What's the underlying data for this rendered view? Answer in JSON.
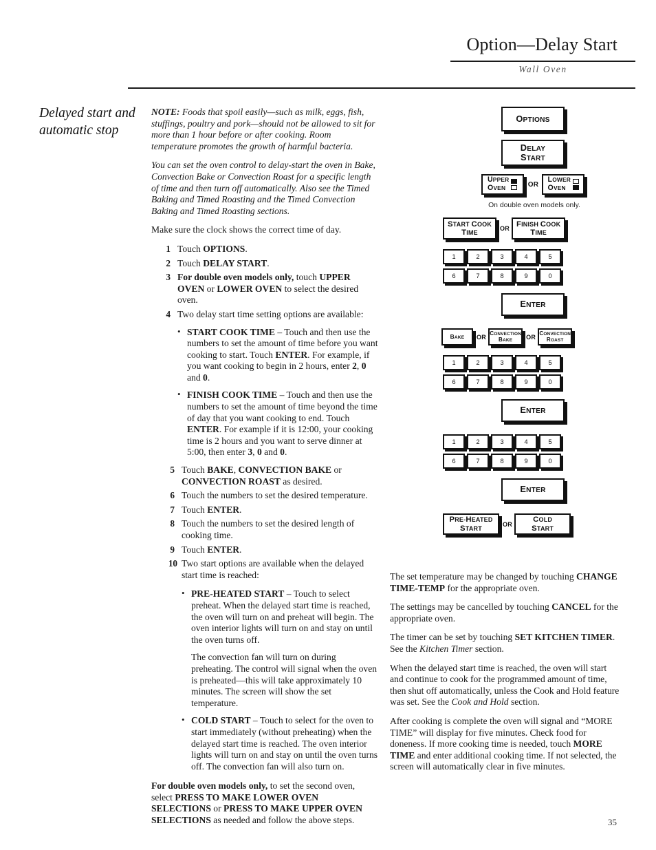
{
  "header": {
    "title": "Option—Delay Start",
    "subtitle": "Wall Oven"
  },
  "sidebar": {
    "heading": "Delayed start and automatic stop"
  },
  "main": {
    "note_label": "NOTE:",
    "note_text": " Foods that spoil easily—such as milk, eggs, fish, stuffings, poultry and pork—should not be allowed to sit for more than 1 hour before or after cooking. Room temperature promotes the growth of harmful bacteria.",
    "intro_italic": "You can set the oven control to delay-start the oven in Bake, Convection Bake or Convection Roast for a specific length of time and then turn off automatically. Also see the Timed Baking and Timed Roasting and the Timed Convection Baking and Timed Roasting sections.",
    "clock_line": "Make sure the clock shows the correct time of day.",
    "steps": [
      {
        "num": "1",
        "html": "Touch <b>OPTIONS</b>."
      },
      {
        "num": "2",
        "html": "Touch <b>DELAY START</b>."
      },
      {
        "num": "3",
        "html": "<b>For double oven models only,</b> touch <b>UPPER OVEN</b> or <b>LOWER OVEN</b> to select the desired oven."
      },
      {
        "num": "4",
        "html": "Two delay start time setting options are available:"
      }
    ],
    "bullet_start_cook": "<b>START COOK TIME</b> – Touch and then use the numbers to set the amount of time before you want cooking to start. Touch <b>ENTER</b>. For example, if you want cooking to begin in 2 hours, enter <b>2</b>, <b>0</b> and <b>0</b>.",
    "bullet_finish_cook": "<b>FINISH COOK TIME</b> – Touch and then use the numbers to set the amount of time beyond the time of day that you want cooking to end. Touch <b>ENTER</b>. For example if it is 12:00, your cooking time is 2 hours and you want to serve dinner at 5:00, then enter <b>3</b>, <b>0</b> and <b>0</b>.",
    "steps2": [
      {
        "num": "5",
        "html": "Touch <b>BAKE</b>, <b>CONVECTION BAKE</b> or <b>CONVECTION ROAST</b> as desired."
      },
      {
        "num": "6",
        "html": "Touch the numbers to set the desired temperature."
      },
      {
        "num": "7",
        "html": "Touch <b>ENTER</b>."
      },
      {
        "num": "8",
        "html": "Touch the numbers to set the desired length of cooking time."
      },
      {
        "num": "9",
        "html": "Touch <b>ENTER</b>."
      },
      {
        "num": "10",
        "html": "Two start options are available when the delayed start time is reached:"
      }
    ],
    "bullet_preheated": "<b>PRE-HEATED START</b> – Touch to select preheat. When the delayed start time is reached, the oven will turn on and preheat will begin. The oven interior lights will turn on and stay on until the oven turns off.",
    "bullet_preheated_cont": "The convection fan will turn on during preheating. The control will signal when the oven is preheated—this will take approximately 10 minutes. The screen will show the set temperature.",
    "bullet_cold_start": "<b>COLD START</b> – Touch to select for the oven to start immediately (without preheating) when the delayed start time is reached. The oven interior lights will turn on and stay on until the oven turns off. The convection fan will also turn on.",
    "double_oven_para": "<b>For double oven models only,</b> to set the second oven, select <b>PRESS TO MAKE LOWER OVEN SELECTIONS</b> or <b>PRESS TO MAKE UPPER OVEN SELECTIONS</b> as needed and follow the above steps."
  },
  "right_text": {
    "para1": "The set temperature may be changed by touching <b>CHANGE TIME-TEMP</b> for the appropriate oven.",
    "para2": "The settings may be cancelled by touching <b>CANCEL</b> for the appropriate oven.",
    "para3": "The timer can be set by touching <b>SET KITCHEN TIMER</b>. See the <i>Kitchen Timer</i> section.",
    "para4": "When the delayed start time is reached, the oven will start and continue to cook for the programmed amount of time, then shut off automatically, unless the Cook and Hold feature was set. See the <i>Cook and Hold</i> section.",
    "para5": "After cooking is complete the oven will signal and “MORE TIME” will display for five minutes. Check food for doneness. If more cooking time is needed, touch <b>MORE TIME</b> and enter additional cooking time. If not selected, the screen will automatically clear in five minutes."
  },
  "keypad": {
    "options": "Options",
    "delay_start_l1": "Delay",
    "delay_start_l2": "Start",
    "upper_oven_l1": "Upper",
    "upper_oven_l2": "Oven",
    "lower_oven_l1": "Lower",
    "lower_oven_l2": "Oven",
    "or": "OR",
    "double_oven_note": "On double oven models only.",
    "start_cook_l1": "Start Cook",
    "start_cook_l2": "Time",
    "finish_cook_l1": "Finish Cook",
    "finish_cook_l2": "Time",
    "numbers_row1": [
      "1",
      "2",
      "3",
      "4",
      "5"
    ],
    "numbers_row2": [
      "6",
      "7",
      "8",
      "9",
      "0"
    ],
    "enter": "Enter",
    "bake": "Bake",
    "convection_bake_l1": "Convection",
    "convection_bake_l2": "Bake",
    "convection_roast_l1": "Convection",
    "convection_roast_l2": "Roast",
    "preheated_l1": "Pre-Heated",
    "preheated_l2": "Start",
    "cold_l1": "Cold",
    "cold_l2": "Start"
  },
  "footer": {
    "page_number": "35"
  }
}
